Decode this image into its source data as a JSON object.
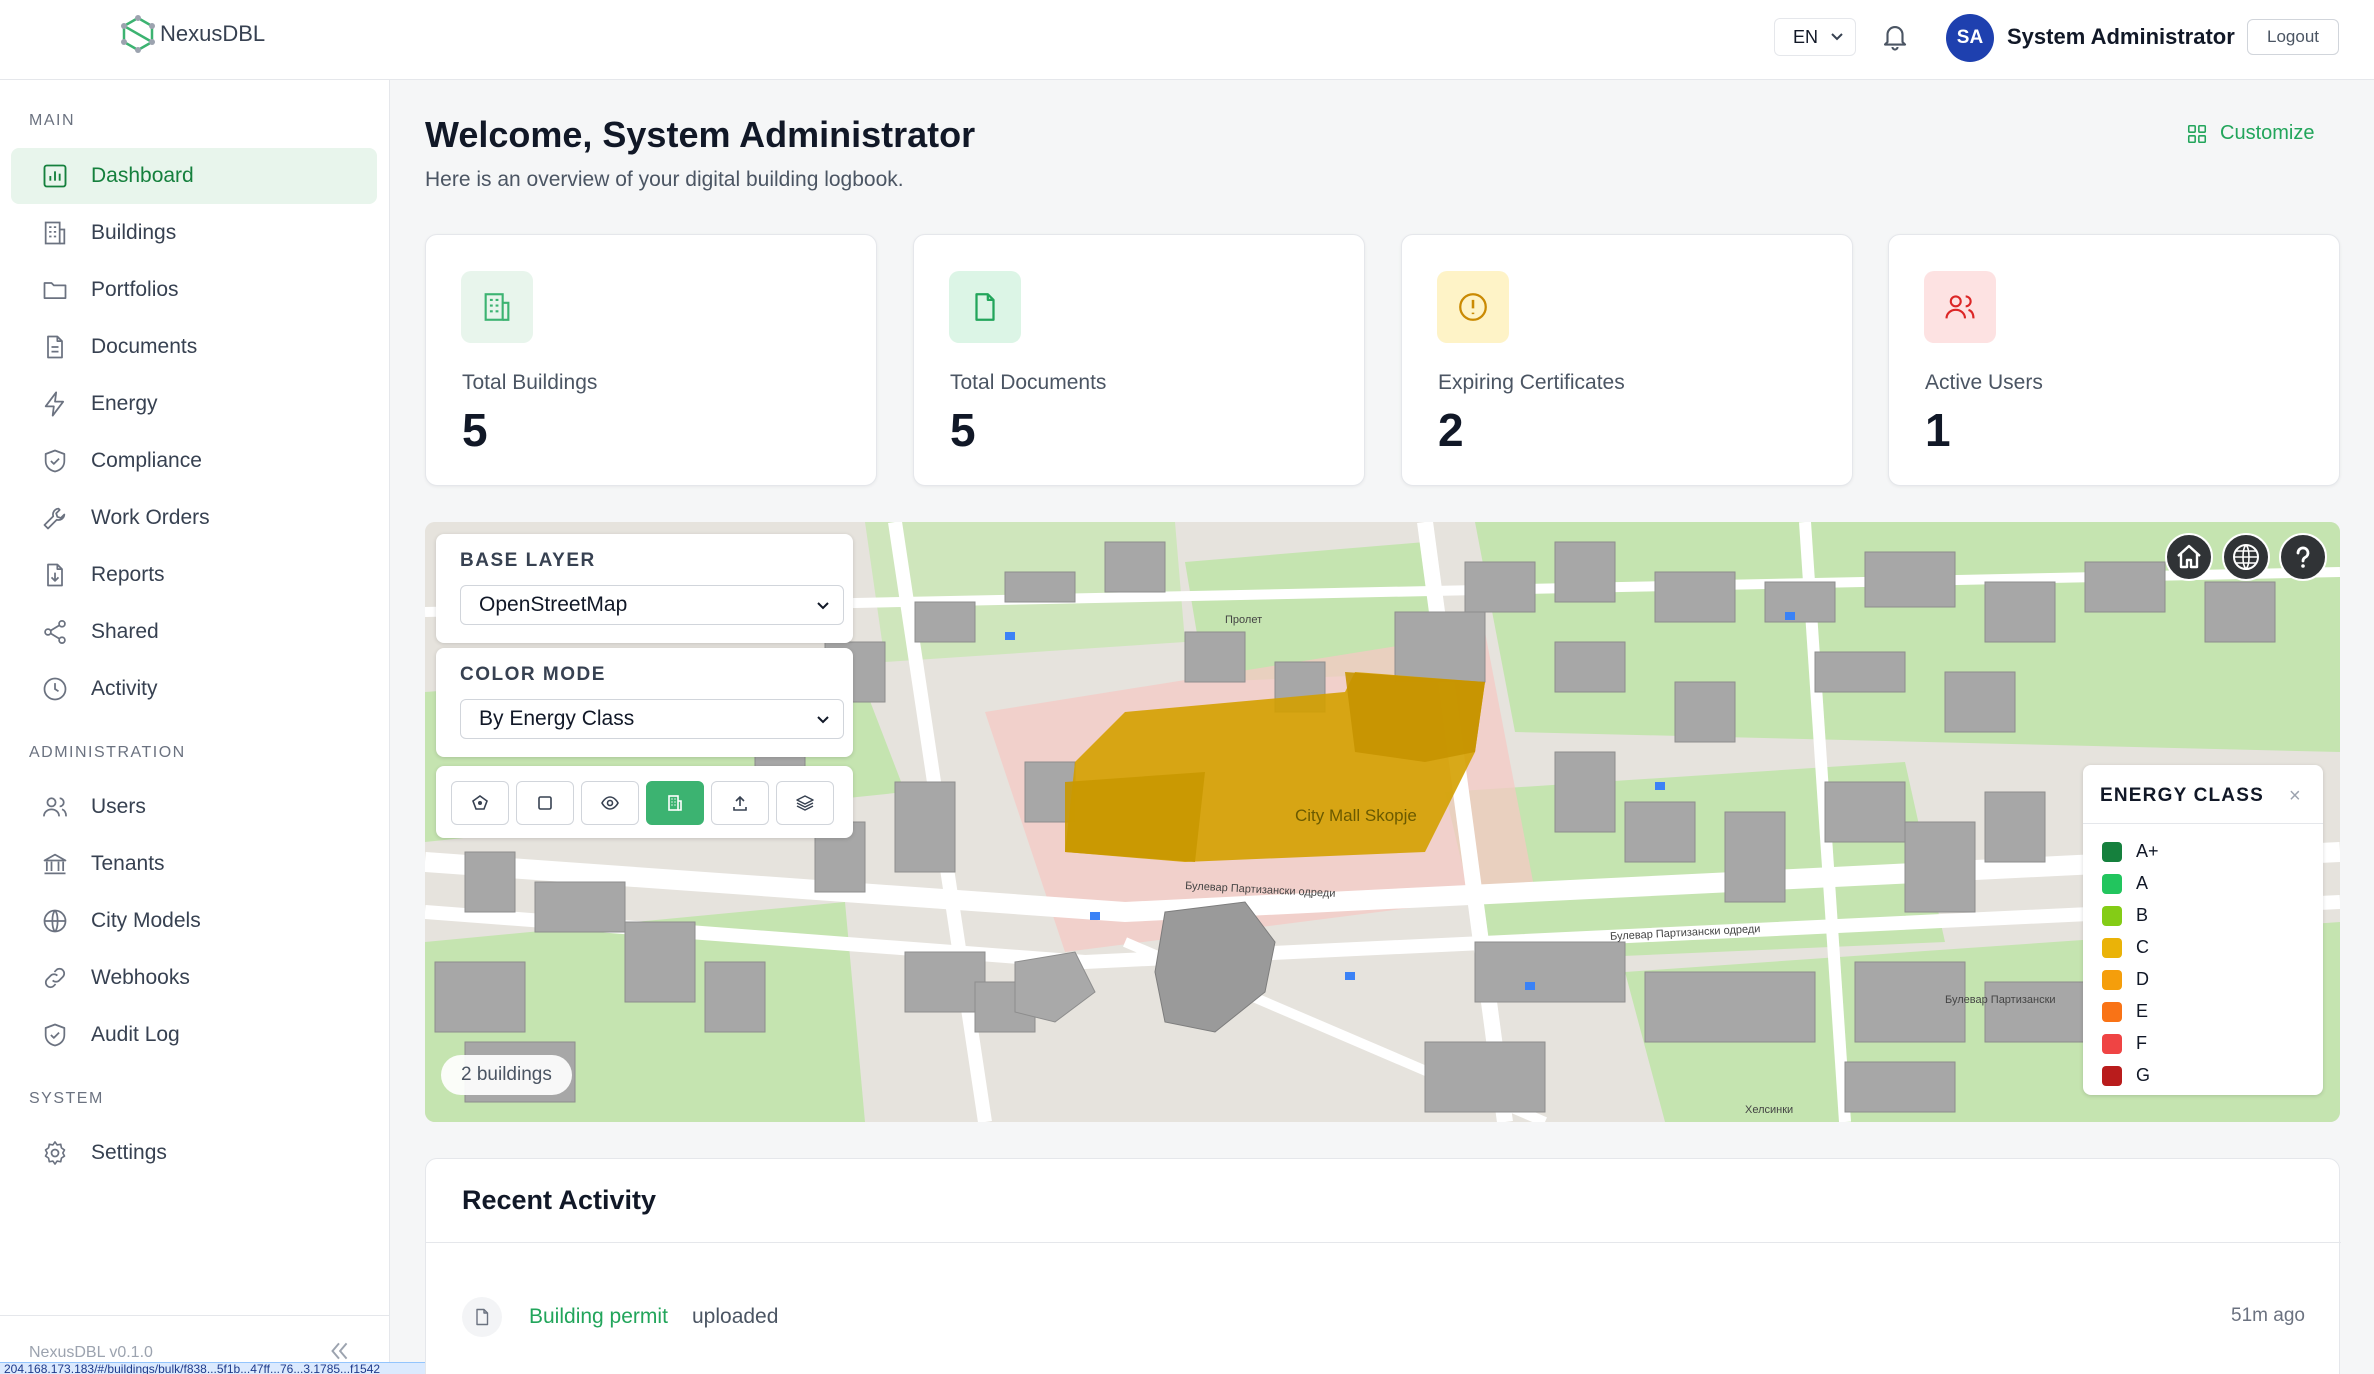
{
  "header": {
    "brand": "NexusDBL",
    "language": "EN",
    "user_initials": "SA",
    "user_name": "System Administrator",
    "logout_label": "Logout"
  },
  "sidebar": {
    "sections": {
      "main": "MAIN",
      "administration": "ADMINISTRATION",
      "system": "SYSTEM"
    },
    "main_items": [
      {
        "label": "Dashboard",
        "icon": "chart-bar-icon",
        "active": true
      },
      {
        "label": "Buildings",
        "icon": "building-icon"
      },
      {
        "label": "Portfolios",
        "icon": "folder-icon"
      },
      {
        "label": "Documents",
        "icon": "document-icon"
      },
      {
        "label": "Energy",
        "icon": "lightning-icon"
      },
      {
        "label": "Compliance",
        "icon": "shield-check-icon"
      },
      {
        "label": "Work Orders",
        "icon": "wrench-icon"
      },
      {
        "label": "Reports",
        "icon": "report-download-icon"
      },
      {
        "label": "Shared",
        "icon": "share-icon"
      },
      {
        "label": "Activity",
        "icon": "clock-icon"
      }
    ],
    "admin_items": [
      {
        "label": "Users",
        "icon": "users-icon"
      },
      {
        "label": "Tenants",
        "icon": "bank-icon"
      },
      {
        "label": "City Models",
        "icon": "globe-icon"
      },
      {
        "label": "Webhooks",
        "icon": "link-icon"
      },
      {
        "label": "Audit Log",
        "icon": "shield-check-icon"
      }
    ],
    "system_items": [
      {
        "label": "Settings",
        "icon": "gear-icon"
      }
    ],
    "version": "NexusDBL v0.1.0",
    "status_url": "204.168.173.183/#/buildings/bulk/f838...5f1b...47ff...76...3.1785...f1542"
  },
  "page": {
    "title": "Welcome, System Administrator",
    "subtitle": "Here is an overview of your digital building logbook.",
    "customize_label": "Customize"
  },
  "stats": [
    {
      "label": "Total Buildings",
      "value": "5",
      "icon": "building-icon",
      "color": "#3cb371",
      "bg": "#e8f5ec"
    },
    {
      "label": "Total Documents",
      "value": "5",
      "icon": "document-icon",
      "color": "#22a55b",
      "bg": "#dcf5e6"
    },
    {
      "label": "Expiring Certificates",
      "value": "2",
      "icon": "alert-circle-icon",
      "color": "#ca8a04",
      "bg": "#fef3c7"
    },
    {
      "label": "Active Users",
      "value": "1",
      "icon": "users-icon",
      "color": "#dc2626",
      "bg": "#fde2e2"
    }
  ],
  "map": {
    "base_layer_label": "BASE LAYER",
    "base_layer_value": "OpenStreetMap",
    "color_mode_label": "COLOR MODE",
    "color_mode_value": "By Energy Class",
    "building_count": "2 buildings",
    "highlight_label": "City Mall Skopje",
    "street_labels": [
      "Булевар Партизански одреди",
      "Булевар Партизански одреди",
      "Булевар Партизански",
      "Хелсинки",
      "Пролет"
    ],
    "legend_title": "ENERGY CLASS",
    "legend_close": "×",
    "energy_classes": [
      {
        "label": "A+",
        "color": "#15803d"
      },
      {
        "label": "A",
        "color": "#22c55e"
      },
      {
        "label": "B",
        "color": "#84cc16"
      },
      {
        "label": "C",
        "color": "#eab308"
      },
      {
        "label": "D",
        "color": "#f59e0b"
      },
      {
        "label": "E",
        "color": "#f97316"
      },
      {
        "label": "F",
        "color": "#ef4444"
      },
      {
        "label": "G",
        "color": "#b91c1c"
      }
    ]
  },
  "activity": {
    "title": "Recent Activity",
    "items": [
      {
        "link": "Building permit",
        "verb": "uploaded",
        "time": "51m ago"
      }
    ]
  }
}
